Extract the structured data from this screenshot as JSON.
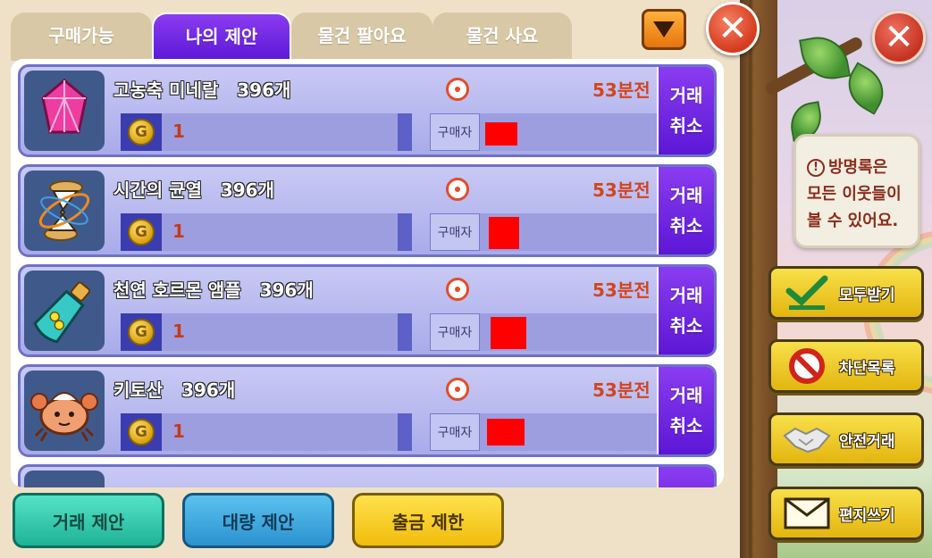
{
  "tabs": [
    {
      "label": "구매가능",
      "active": false
    },
    {
      "label": "나의 제안",
      "active": true
    },
    {
      "label": "물건 팔아요",
      "active": false
    },
    {
      "label": "물건 사요",
      "active": false
    }
  ],
  "trades": [
    {
      "name": "고농축 미네랄   396개",
      "icon": "pink-crystal-icon",
      "time": "53분전",
      "price": "1",
      "buyer_label": "구매자",
      "cancel_top": "거래",
      "cancel_bottom": "취소"
    },
    {
      "name": "시간의 균열   396개",
      "icon": "hourglass-rift-icon",
      "time": "53분전",
      "price": "1",
      "buyer_label": "구매자",
      "cancel_top": "거래",
      "cancel_bottom": "취소"
    },
    {
      "name": "천연 호르몬 앰플   396개",
      "icon": "ampoule-icon",
      "time": "53분전",
      "price": "1",
      "buyer_label": "구매자",
      "cancel_top": "거래",
      "cancel_bottom": "취소"
    },
    {
      "name": "키토산   396개",
      "icon": "crab-icon",
      "time": "53분전",
      "price": "1",
      "buyer_label": "구매자",
      "cancel_top": "거래",
      "cancel_bottom": "취소"
    }
  ],
  "coin_symbol": "G",
  "bottom_buttons": {
    "trade_offer": "거래 제안",
    "bulk_offer": "대량 제안",
    "withdraw_limit": "출금 제한"
  },
  "notice": {
    "icon": "!",
    "line1": "방명록은",
    "line2": "모든 이웃들이",
    "line3": "볼 수 있어요."
  },
  "side_buttons": {
    "receive_all": "모두받기",
    "block_list": "차단목록",
    "safe_trade": "안전거래",
    "write_letter": "편지쓰기"
  },
  "colors": {
    "tab_active": "#5c17d6",
    "price_text": "#c43b1b",
    "time_text": "#d2451f",
    "row_bg": "#a9abea"
  }
}
